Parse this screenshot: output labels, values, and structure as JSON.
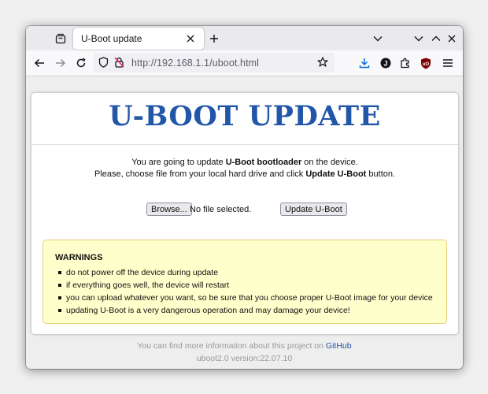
{
  "tab": {
    "title": "U-Boot update"
  },
  "nav": {
    "url": "http://192.168.1.1/uboot.html"
  },
  "page": {
    "title": "U-BOOT UPDATE",
    "line1": {
      "pre": "You are going to update ",
      "bold": "U-Boot bootloader",
      "post": " on the device."
    },
    "line2": {
      "pre": "Please, choose file from your local hard drive and click ",
      "bold": "Update U-Boot",
      "post": " button."
    },
    "browse_label": "Browse...",
    "file_status": "No file selected.",
    "update_label": "Update U-Boot",
    "warnings": {
      "title": "WARNINGS",
      "items": [
        "do not power off the device during update",
        "if everything goes well, the device will restart",
        "you can upload whatever you want, so be sure that you choose proper U-Boot image for your device",
        "updating U-Boot is a very dangerous operation and may damage your device!"
      ]
    },
    "footer": {
      "info_pre": "You can find more information about this project on ",
      "link": "GitHub",
      "version": "uboot2.0 version:22.07.10"
    }
  },
  "colors": {
    "title_blue": "#2256a8",
    "warn_bg": "#ffffcc",
    "warn_border": "#e8cf7a"
  }
}
